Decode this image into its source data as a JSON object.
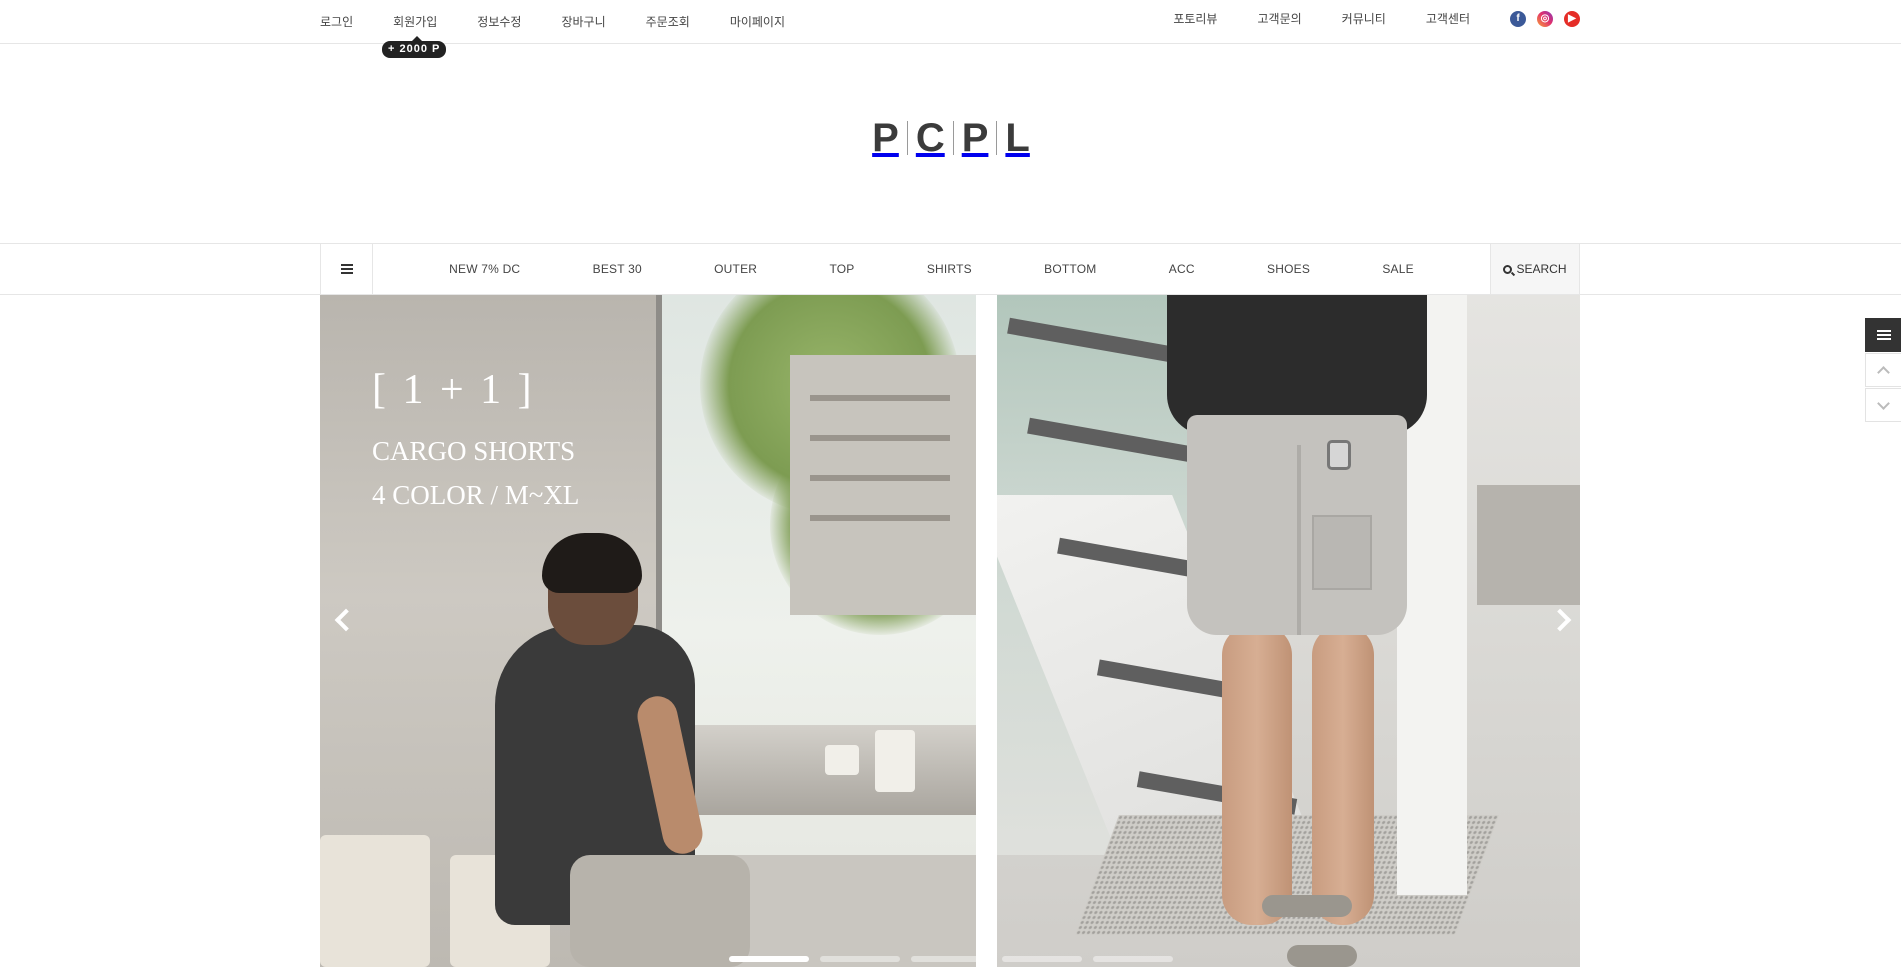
{
  "util_nav_left": [
    {
      "label": "로그인"
    },
    {
      "label": "회원가입"
    },
    {
      "label": "정보수정"
    },
    {
      "label": "장바구니"
    },
    {
      "label": "주문조회"
    },
    {
      "label": "마이페이지"
    }
  ],
  "signup_point_badge": "+ 2000 P",
  "util_nav_right": [
    {
      "label": "포토리뷰"
    },
    {
      "label": "고객문의"
    },
    {
      "label": "커뮤니티"
    },
    {
      "label": "고객센터"
    }
  ],
  "social_icons": [
    "facebook-icon",
    "instagram-icon",
    "youtube-icon"
  ],
  "logo": {
    "letters": [
      "P",
      "C",
      "P",
      "L"
    ]
  },
  "category_nav": {
    "items": [
      {
        "label": "NEW 7% DC"
      },
      {
        "label": "BEST 30"
      },
      {
        "label": "OUTER"
      },
      {
        "label": "TOP"
      },
      {
        "label": "SHIRTS"
      },
      {
        "label": "BOTTOM"
      },
      {
        "label": "ACC"
      },
      {
        "label": "SHOES"
      },
      {
        "label": "SALE"
      }
    ],
    "search_label": "SEARCH"
  },
  "hero": {
    "line1": "[ 1 + 1 ]",
    "line2": "CARGO SHORTS",
    "line3": "4 COLOR / M~XL",
    "slide_count": 5,
    "active_slide": 1
  },
  "colors": {
    "text": "#444444",
    "badge_bg": "#222222",
    "border": "#e6e6e6",
    "facebook": "#3b5998",
    "youtube": "#e52d27"
  }
}
